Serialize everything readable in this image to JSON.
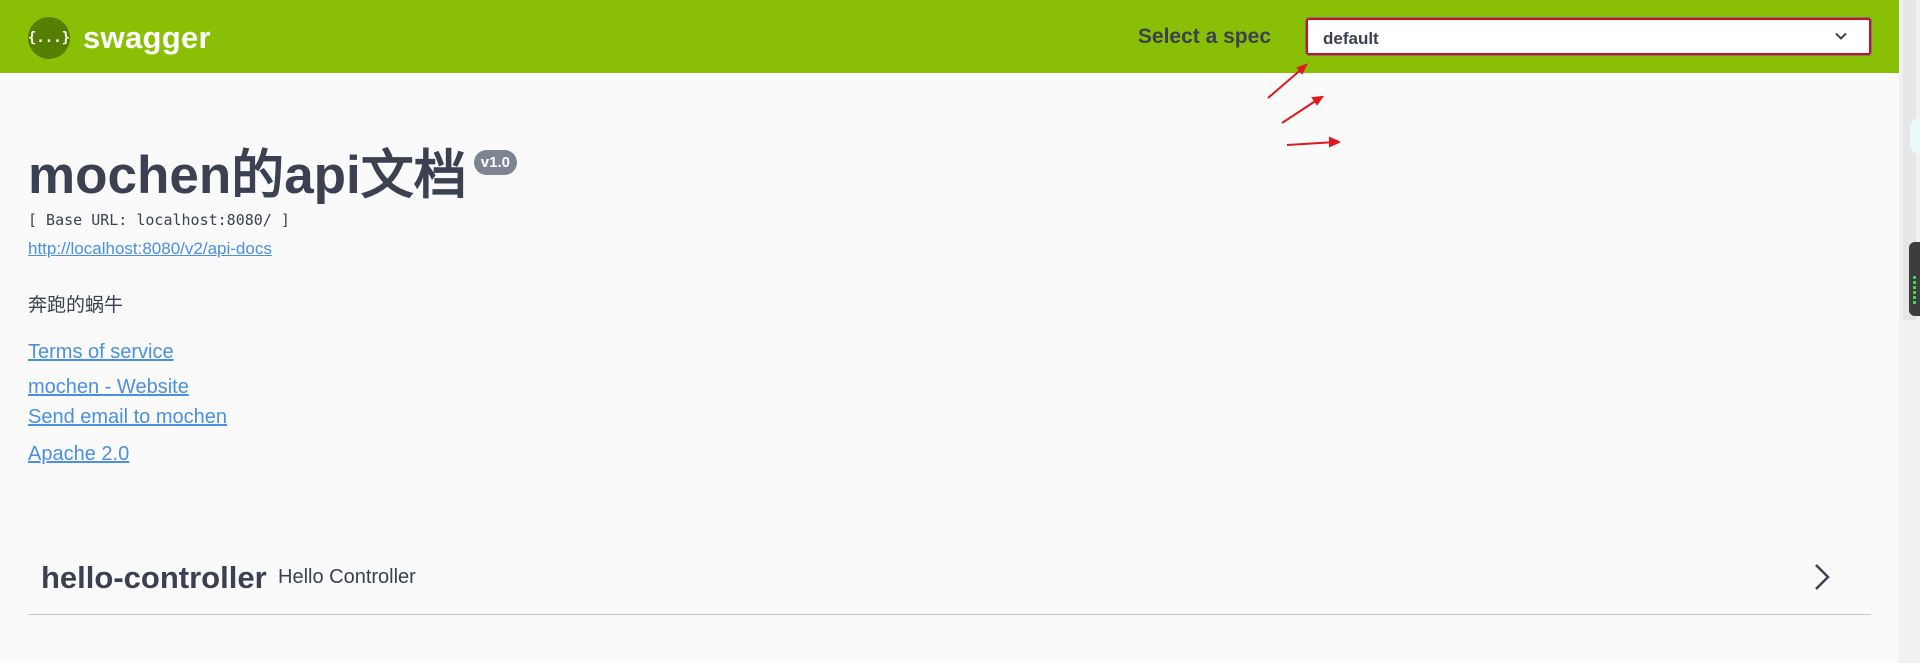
{
  "topbar": {
    "logo_glyph": "{...}",
    "logo_text": "swagger",
    "spec_label": "Select a spec",
    "spec_value": "default",
    "accent_color": "#89bf04",
    "highlight_color": "#c0141e"
  },
  "info": {
    "title": "mochen的api文档",
    "version": "v1.0",
    "base_url": "[ Base URL: localhost:8080/ ]",
    "api_docs_link": "http://localhost:8080/v2/api-docs",
    "description": "奔跑的蜗牛",
    "terms_link": "Terms of service",
    "website_link": "mochen - Website",
    "email_link": "Send email to mochen",
    "license_link": "Apache 2.0"
  },
  "tags": [
    {
      "name": "hello-controller",
      "description": "Hello Controller",
      "expand_icon": "chevron-right-icon"
    }
  ]
}
